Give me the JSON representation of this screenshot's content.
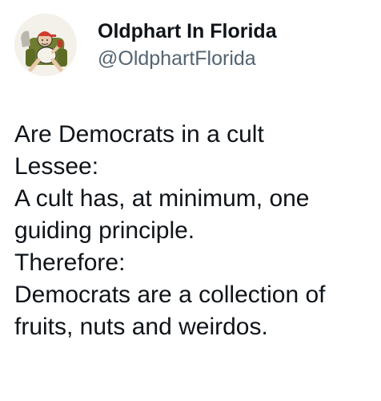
{
  "author": {
    "display_name": "Oldphart In Florida",
    "handle": "@OldphartFlorida",
    "avatar_icon": "cartoon-old-man-avatar-icon"
  },
  "tweet": {
    "lines": [
      "Are Democrats in a cult",
      "Lessee:",
      "A cult has, at minimum, one",
      "guiding principle.",
      "Therefore:",
      "Democrats are a collection of",
      "fruits, nuts and weirdos."
    ]
  },
  "colors": {
    "text": "#0f1419",
    "secondary": "#536471",
    "background": "#ffffff"
  }
}
